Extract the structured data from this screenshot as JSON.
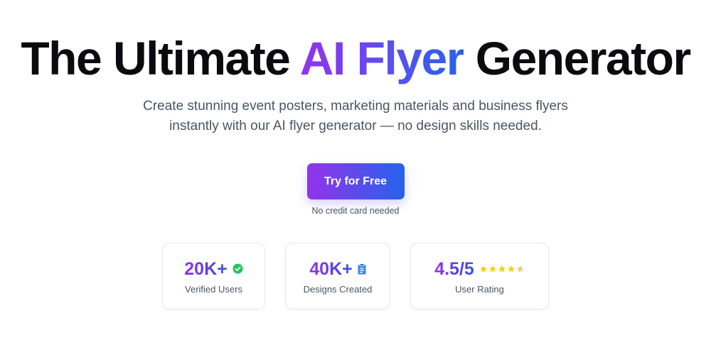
{
  "hero": {
    "title_prefix": "The Ultimate",
    "title_highlight": "AI Flyer",
    "title_suffix": "Generator",
    "subtitle_line1": "Create stunning event posters, marketing materials and business flyers",
    "subtitle_line2": "instantly with our AI flyer generator — no design skills needed.",
    "cta_label": "Try for Free",
    "cta_note": "No credit card needed"
  },
  "stats": [
    {
      "value": "20K+",
      "label": "Verified Users",
      "icon": "check-circle-icon"
    },
    {
      "value": "40K+",
      "label": "Designs Created",
      "icon": "clipboard-icon"
    },
    {
      "value": "4.5/5",
      "label": "User Rating",
      "icon": "star-rating-icon",
      "rating": 4.5,
      "max_rating": 5
    }
  ],
  "colors": {
    "gradient_start": "#9333ea",
    "gradient_end": "#2563eb",
    "check_green": "#22c55e",
    "clipboard_blue": "#3b82f6",
    "star_gold": "#facc15",
    "text_dark": "#0b0b0f",
    "text_muted": "#4b5563"
  }
}
